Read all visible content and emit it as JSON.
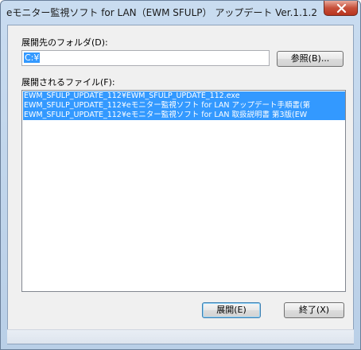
{
  "window": {
    "title": "eモニター監視ソフト for LAN（EWM SFULP） アップデート Ver.1.1.2",
    "close_icon": "close-icon"
  },
  "dest_folder": {
    "label": "展開先のフォルダ(D):",
    "value": "C:¥",
    "browse_label": "参照(B)..."
  },
  "files": {
    "label": "展開されるファイル(F):",
    "items": [
      "EWM_SFULP_UPDATE_112¥EWM_SFULP_UPDATE_112.exe",
      "EWM_SFULP_UPDATE_112¥eモニター監視ソフト for LAN アップデート手順書(第",
      "EWM_SFULP_UPDATE_112¥eモニター監視ソフト for LAN 取扱説明書 第3版(EW"
    ]
  },
  "buttons": {
    "extract": "展開(E)",
    "exit": "終了(X)"
  },
  "colors": {
    "selection": "#3399ff",
    "close_button": "#c7503a"
  }
}
